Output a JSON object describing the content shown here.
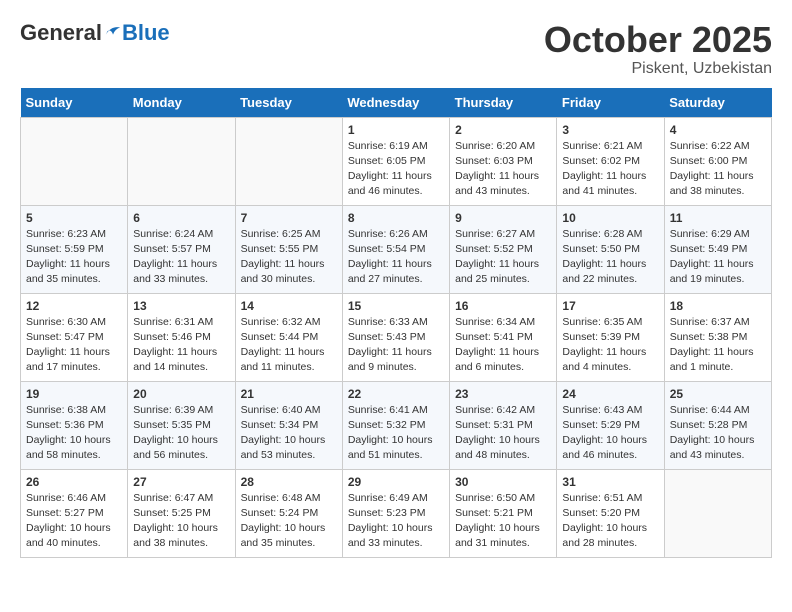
{
  "header": {
    "logo_general": "General",
    "logo_blue": "Blue",
    "month_title": "October 2025",
    "location": "Piskent, Uzbekistan"
  },
  "days_of_week": [
    "Sunday",
    "Monday",
    "Tuesday",
    "Wednesday",
    "Thursday",
    "Friday",
    "Saturday"
  ],
  "weeks": [
    [
      {
        "day": "",
        "info": ""
      },
      {
        "day": "",
        "info": ""
      },
      {
        "day": "",
        "info": ""
      },
      {
        "day": "1",
        "info": "Sunrise: 6:19 AM\nSunset: 6:05 PM\nDaylight: 11 hours\nand 46 minutes."
      },
      {
        "day": "2",
        "info": "Sunrise: 6:20 AM\nSunset: 6:03 PM\nDaylight: 11 hours\nand 43 minutes."
      },
      {
        "day": "3",
        "info": "Sunrise: 6:21 AM\nSunset: 6:02 PM\nDaylight: 11 hours\nand 41 minutes."
      },
      {
        "day": "4",
        "info": "Sunrise: 6:22 AM\nSunset: 6:00 PM\nDaylight: 11 hours\nand 38 minutes."
      }
    ],
    [
      {
        "day": "5",
        "info": "Sunrise: 6:23 AM\nSunset: 5:59 PM\nDaylight: 11 hours\nand 35 minutes."
      },
      {
        "day": "6",
        "info": "Sunrise: 6:24 AM\nSunset: 5:57 PM\nDaylight: 11 hours\nand 33 minutes."
      },
      {
        "day": "7",
        "info": "Sunrise: 6:25 AM\nSunset: 5:55 PM\nDaylight: 11 hours\nand 30 minutes."
      },
      {
        "day": "8",
        "info": "Sunrise: 6:26 AM\nSunset: 5:54 PM\nDaylight: 11 hours\nand 27 minutes."
      },
      {
        "day": "9",
        "info": "Sunrise: 6:27 AM\nSunset: 5:52 PM\nDaylight: 11 hours\nand 25 minutes."
      },
      {
        "day": "10",
        "info": "Sunrise: 6:28 AM\nSunset: 5:50 PM\nDaylight: 11 hours\nand 22 minutes."
      },
      {
        "day": "11",
        "info": "Sunrise: 6:29 AM\nSunset: 5:49 PM\nDaylight: 11 hours\nand 19 minutes."
      }
    ],
    [
      {
        "day": "12",
        "info": "Sunrise: 6:30 AM\nSunset: 5:47 PM\nDaylight: 11 hours\nand 17 minutes."
      },
      {
        "day": "13",
        "info": "Sunrise: 6:31 AM\nSunset: 5:46 PM\nDaylight: 11 hours\nand 14 minutes."
      },
      {
        "day": "14",
        "info": "Sunrise: 6:32 AM\nSunset: 5:44 PM\nDaylight: 11 hours\nand 11 minutes."
      },
      {
        "day": "15",
        "info": "Sunrise: 6:33 AM\nSunset: 5:43 PM\nDaylight: 11 hours\nand 9 minutes."
      },
      {
        "day": "16",
        "info": "Sunrise: 6:34 AM\nSunset: 5:41 PM\nDaylight: 11 hours\nand 6 minutes."
      },
      {
        "day": "17",
        "info": "Sunrise: 6:35 AM\nSunset: 5:39 PM\nDaylight: 11 hours\nand 4 minutes."
      },
      {
        "day": "18",
        "info": "Sunrise: 6:37 AM\nSunset: 5:38 PM\nDaylight: 11 hours\nand 1 minute."
      }
    ],
    [
      {
        "day": "19",
        "info": "Sunrise: 6:38 AM\nSunset: 5:36 PM\nDaylight: 10 hours\nand 58 minutes."
      },
      {
        "day": "20",
        "info": "Sunrise: 6:39 AM\nSunset: 5:35 PM\nDaylight: 10 hours\nand 56 minutes."
      },
      {
        "day": "21",
        "info": "Sunrise: 6:40 AM\nSunset: 5:34 PM\nDaylight: 10 hours\nand 53 minutes."
      },
      {
        "day": "22",
        "info": "Sunrise: 6:41 AM\nSunset: 5:32 PM\nDaylight: 10 hours\nand 51 minutes."
      },
      {
        "day": "23",
        "info": "Sunrise: 6:42 AM\nSunset: 5:31 PM\nDaylight: 10 hours\nand 48 minutes."
      },
      {
        "day": "24",
        "info": "Sunrise: 6:43 AM\nSunset: 5:29 PM\nDaylight: 10 hours\nand 46 minutes."
      },
      {
        "day": "25",
        "info": "Sunrise: 6:44 AM\nSunset: 5:28 PM\nDaylight: 10 hours\nand 43 minutes."
      }
    ],
    [
      {
        "day": "26",
        "info": "Sunrise: 6:46 AM\nSunset: 5:27 PM\nDaylight: 10 hours\nand 40 minutes."
      },
      {
        "day": "27",
        "info": "Sunrise: 6:47 AM\nSunset: 5:25 PM\nDaylight: 10 hours\nand 38 minutes."
      },
      {
        "day": "28",
        "info": "Sunrise: 6:48 AM\nSunset: 5:24 PM\nDaylight: 10 hours\nand 35 minutes."
      },
      {
        "day": "29",
        "info": "Sunrise: 6:49 AM\nSunset: 5:23 PM\nDaylight: 10 hours\nand 33 minutes."
      },
      {
        "day": "30",
        "info": "Sunrise: 6:50 AM\nSunset: 5:21 PM\nDaylight: 10 hours\nand 31 minutes."
      },
      {
        "day": "31",
        "info": "Sunrise: 6:51 AM\nSunset: 5:20 PM\nDaylight: 10 hours\nand 28 minutes."
      },
      {
        "day": "",
        "info": ""
      }
    ]
  ]
}
